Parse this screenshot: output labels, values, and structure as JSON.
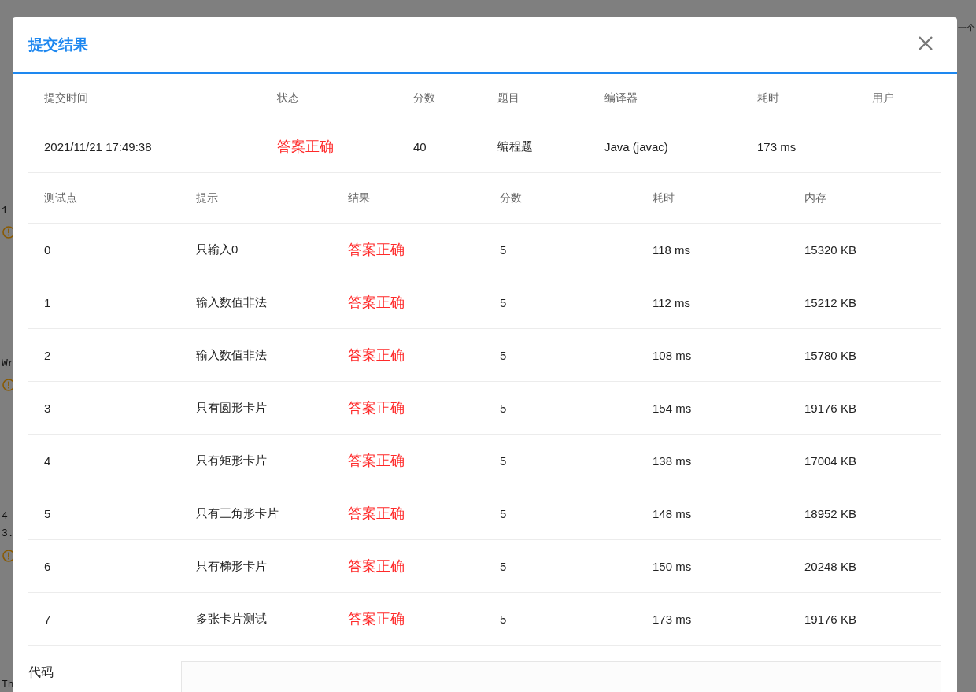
{
  "backdrop": {
    "texts": [
      "1",
      "Wr",
      "4",
      "3.",
      "Th"
    ],
    "corner_text": "一个"
  },
  "dialog": {
    "title": "提交结果",
    "summary": {
      "columns": [
        "提交时间",
        "状态",
        "分数",
        "题目",
        "编译器",
        "耗时",
        "用户"
      ],
      "row": [
        "2021/11/21 17:49:38",
        "答案正确",
        "40",
        "编程题",
        "Java (javac)",
        "173 ms"
      ]
    },
    "cases": {
      "columns": [
        "测试点",
        "提示",
        "结果",
        "分数",
        "耗时",
        "内存"
      ],
      "rows": [
        [
          "0",
          "只输入0",
          "答案正确",
          "5",
          "118 ms",
          "15320 KB"
        ],
        [
          "1",
          "输入数值非法",
          "答案正确",
          "5",
          "112 ms",
          "15212 KB"
        ],
        [
          "2",
          "输入数值非法",
          "答案正确",
          "5",
          "108 ms",
          "15780 KB"
        ],
        [
          "3",
          "只有圆形卡片",
          "答案正确",
          "5",
          "154 ms",
          "19176 KB"
        ],
        [
          "4",
          "只有矩形卡片",
          "答案正确",
          "5",
          "138 ms",
          "17004 KB"
        ],
        [
          "5",
          "只有三角形卡片",
          "答案正确",
          "5",
          "148 ms",
          "18952 KB"
        ],
        [
          "6",
          "只有梯形卡片",
          "答案正确",
          "5",
          "150 ms",
          "20248 KB"
        ],
        [
          "7",
          "多张卡片测试",
          "答案正确",
          "5",
          "173 ms",
          "19176 KB"
        ]
      ]
    },
    "code_label": "代码"
  }
}
